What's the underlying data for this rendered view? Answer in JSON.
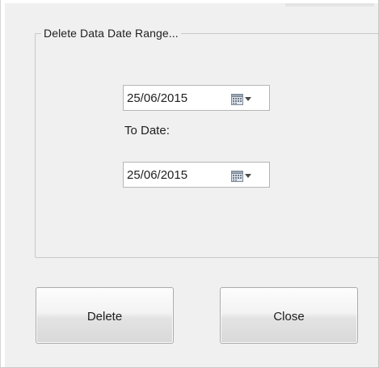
{
  "dialog": {
    "group_title": "Delete Data Date Range...",
    "from_date": {
      "value": "25/06/2015",
      "icon": "calendar-icon"
    },
    "to_date_label": "To Date:",
    "to_date": {
      "value": "25/06/2015",
      "icon": "calendar-icon"
    },
    "buttons": {
      "delete_label": "Delete",
      "close_label": "Close"
    }
  },
  "colors": {
    "window_background": "#f0f0f0",
    "field_background": "#ffffff",
    "field_border": "#b6b6b6",
    "group_border": "#c8c8c8",
    "button_border": "#acacac",
    "text": "#1e1e1e"
  }
}
